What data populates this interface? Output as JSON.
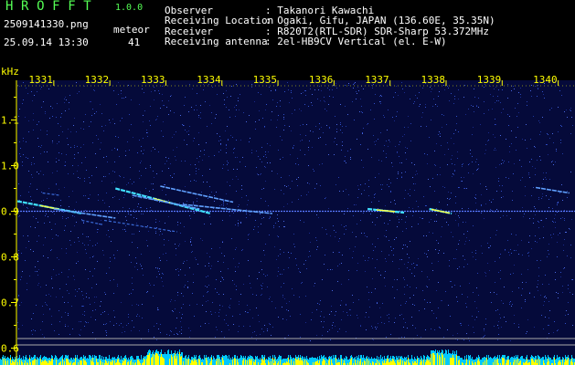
{
  "header": {
    "app_name": "H R O F F T",
    "version": "1.0.0",
    "filename": "2509141330.png",
    "datetime": "25.09.14 13:30",
    "meteor_label": "meteor",
    "meteor_count": "41",
    "info": [
      {
        "key": "Observer",
        "value": ": Takanori Kawachi"
      },
      {
        "key": "Receiving Location",
        "value": ": Ogaki, Gifu, JAPAN (136.60E, 35.35N)"
      },
      {
        "key": "Receiver",
        "value": ": R820T2(RTL-SDR) SDR-Sharp 53.372MHz"
      },
      {
        "key": "Receiving antenna",
        "value": ": 2el-HB9CV Vertical (el. E-W)"
      }
    ]
  },
  "colors": {
    "background": "#000000",
    "plot_background": "#050a3a",
    "label_yellow": "#ffff00",
    "header_green": "#55ff55",
    "signal_cyan": "#40e0ff",
    "signal_yellow": "#ffff40",
    "reference_line": "#aaaaaa"
  },
  "chart_data": {
    "type": "heatmap",
    "y_unit": "kHz",
    "x_ticks": [
      "1331",
      "1332",
      "1333",
      "1334",
      "1335",
      "1336",
      "1337",
      "1338",
      "1339",
      "1340"
    ],
    "x_values": [
      1331,
      1332,
      1333,
      1334,
      1335,
      1336,
      1337,
      1338,
      1339,
      1340
    ],
    "y_ticks": [
      "1.1",
      "1.0",
      "0.9",
      "0.8",
      "0.7",
      "0.6"
    ],
    "y_values": [
      1.1,
      1.0,
      0.9,
      0.8,
      0.7,
      0.6
    ],
    "xlim": [
      1330.35,
      1340.3
    ],
    "ylim": [
      0.575,
      1.175
    ],
    "carrier_khz": 0.9,
    "meteor_traces": [
      {
        "t_start": 1330.35,
        "f_start": 0.922,
        "t_end": 1331.5,
        "f_end": 0.895,
        "strength": "strong"
      },
      {
        "t_start": 1331.0,
        "f_start": 0.905,
        "t_end": 1332.1,
        "f_end": 0.885,
        "strength": "medium"
      },
      {
        "t_start": 1332.1,
        "f_start": 0.95,
        "t_end": 1333.8,
        "f_end": 0.895,
        "strength": "strong"
      },
      {
        "t_start": 1332.4,
        "f_start": 0.935,
        "t_end": 1333.6,
        "f_end": 0.905,
        "strength": "medium"
      },
      {
        "t_start": 1332.9,
        "f_start": 0.955,
        "t_end": 1334.2,
        "f_end": 0.92,
        "strength": "medium"
      },
      {
        "t_start": 1331.9,
        "f_start": 0.88,
        "t_end": 1333.2,
        "f_end": 0.855,
        "strength": "weak"
      },
      {
        "t_start": 1331.5,
        "f_start": 0.88,
        "t_end": 1331.9,
        "f_end": 0.87,
        "strength": "weak"
      },
      {
        "t_start": 1333.3,
        "f_start": 0.915,
        "t_end": 1334.9,
        "f_end": 0.895,
        "strength": "medium"
      },
      {
        "t_start": 1336.6,
        "f_start": 0.905,
        "t_end": 1337.25,
        "f_end": 0.897,
        "strength": "strong"
      },
      {
        "t_start": 1337.7,
        "f_start": 0.905,
        "t_end": 1338.1,
        "f_end": 0.895,
        "strength": "strong"
      },
      {
        "t_start": 1339.6,
        "f_start": 0.952,
        "t_end": 1340.2,
        "f_end": 0.94,
        "strength": "medium"
      },
      {
        "t_start": 1330.8,
        "f_start": 0.94,
        "t_end": 1331.1,
        "f_end": 0.935,
        "strength": "weak"
      }
    ]
  }
}
